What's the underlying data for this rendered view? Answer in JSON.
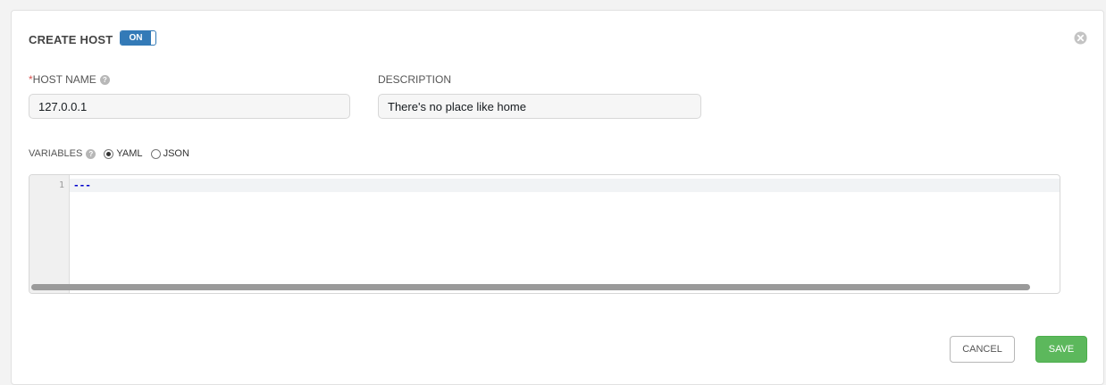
{
  "header": {
    "title": "CREATE HOST",
    "toggle_label": "ON"
  },
  "form": {
    "host_name": {
      "required_mark": "*",
      "label": "HOST NAME",
      "value": "127.0.0.1"
    },
    "description": {
      "label": "DESCRIPTION",
      "value": "There's no place like home"
    },
    "variables": {
      "label": "VARIABLES",
      "formats": [
        "YAML",
        "JSON"
      ],
      "selected_format": "YAML",
      "editor": {
        "line_number": "1",
        "content": "---"
      }
    }
  },
  "actions": {
    "cancel_label": "CANCEL",
    "save_label": "SAVE"
  },
  "colors": {
    "toggle_blue": "#337ab7",
    "save_green": "#5cb85c",
    "required_red": "#d9534f"
  },
  "icons": [
    "close-icon",
    "help-icon"
  ]
}
